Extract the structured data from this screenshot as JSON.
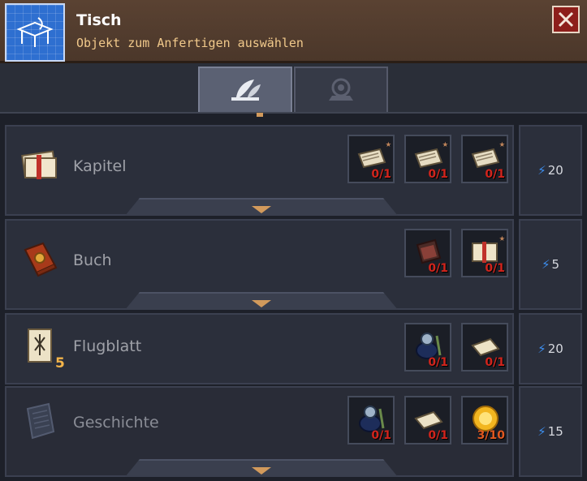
{
  "header": {
    "title": "Tisch",
    "subtitle": "Objekt zum Anfertigen auswählen"
  },
  "tabs": [
    {
      "name": "quill-tab",
      "active": true
    },
    {
      "name": "scroll-tab",
      "active": false
    }
  ],
  "recipes": [
    {
      "name": "Kapitel",
      "ingredients": [
        {
          "icon": "paper-stack-icon",
          "count": "0/1"
        },
        {
          "icon": "paper-stack-icon",
          "count": "0/1"
        },
        {
          "icon": "paper-stack-icon",
          "count": "0/1"
        }
      ],
      "energy": "20"
    },
    {
      "name": "Buch",
      "ingredients": [
        {
          "icon": "leather-cover-icon",
          "count": "0/1"
        },
        {
          "icon": "chapter-bundle-icon",
          "count": "0/1"
        }
      ],
      "energy": "5"
    },
    {
      "name": "Flugblatt",
      "quantity": "5",
      "ingredients": [
        {
          "icon": "ink-bottle-icon",
          "count": "0/1"
        },
        {
          "icon": "paper-sheet-icon",
          "count": "0/1"
        }
      ],
      "energy": "20"
    },
    {
      "name": "Geschichte",
      "ingredients": [
        {
          "icon": "ink-bottle-icon",
          "count": "0/1"
        },
        {
          "icon": "paper-sheet-icon",
          "count": "0/1"
        },
        {
          "icon": "golden-orb-icon",
          "count": "3/10"
        }
      ],
      "energy": "15"
    }
  ]
}
